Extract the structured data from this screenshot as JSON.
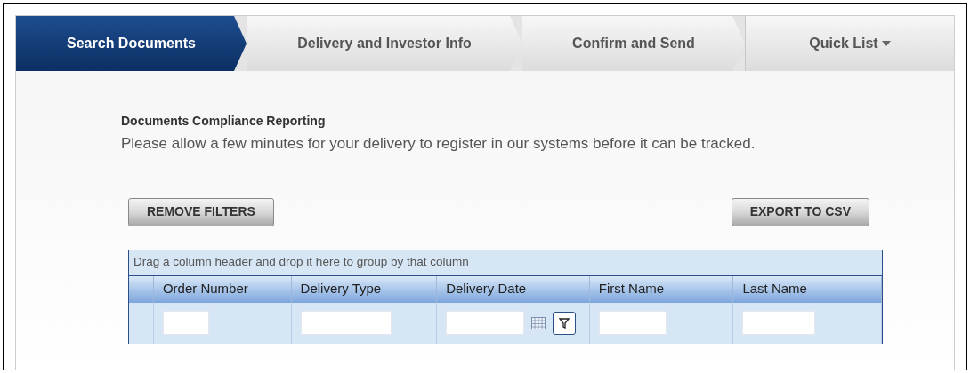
{
  "tabs": [
    {
      "label": "Search Documents",
      "selected": true,
      "kind": "step"
    },
    {
      "label": "Delivery and Investor Info",
      "selected": false,
      "kind": "step"
    },
    {
      "label": "Confirm and Send",
      "selected": false,
      "kind": "step"
    },
    {
      "label": "Quick List",
      "selected": false,
      "kind": "menu"
    }
  ],
  "heading": "Documents Compliance Reporting",
  "description": "Please allow a few minutes for your delivery to register in our systems before it can be tracked.",
  "buttons": [
    "REMOVE FILTERS",
    "EXPORT TO CSV"
  ],
  "grid": {
    "group_hint": "Drag a column header and drop it here to group by that column",
    "columns": [
      {
        "label": "Order Number",
        "kind": "text"
      },
      {
        "label": "Delivery Type",
        "kind": "text"
      },
      {
        "label": "Delivery Date",
        "kind": "date"
      },
      {
        "label": "First Name",
        "kind": "text"
      },
      {
        "label": "Last Name",
        "kind": "text"
      }
    ]
  }
}
